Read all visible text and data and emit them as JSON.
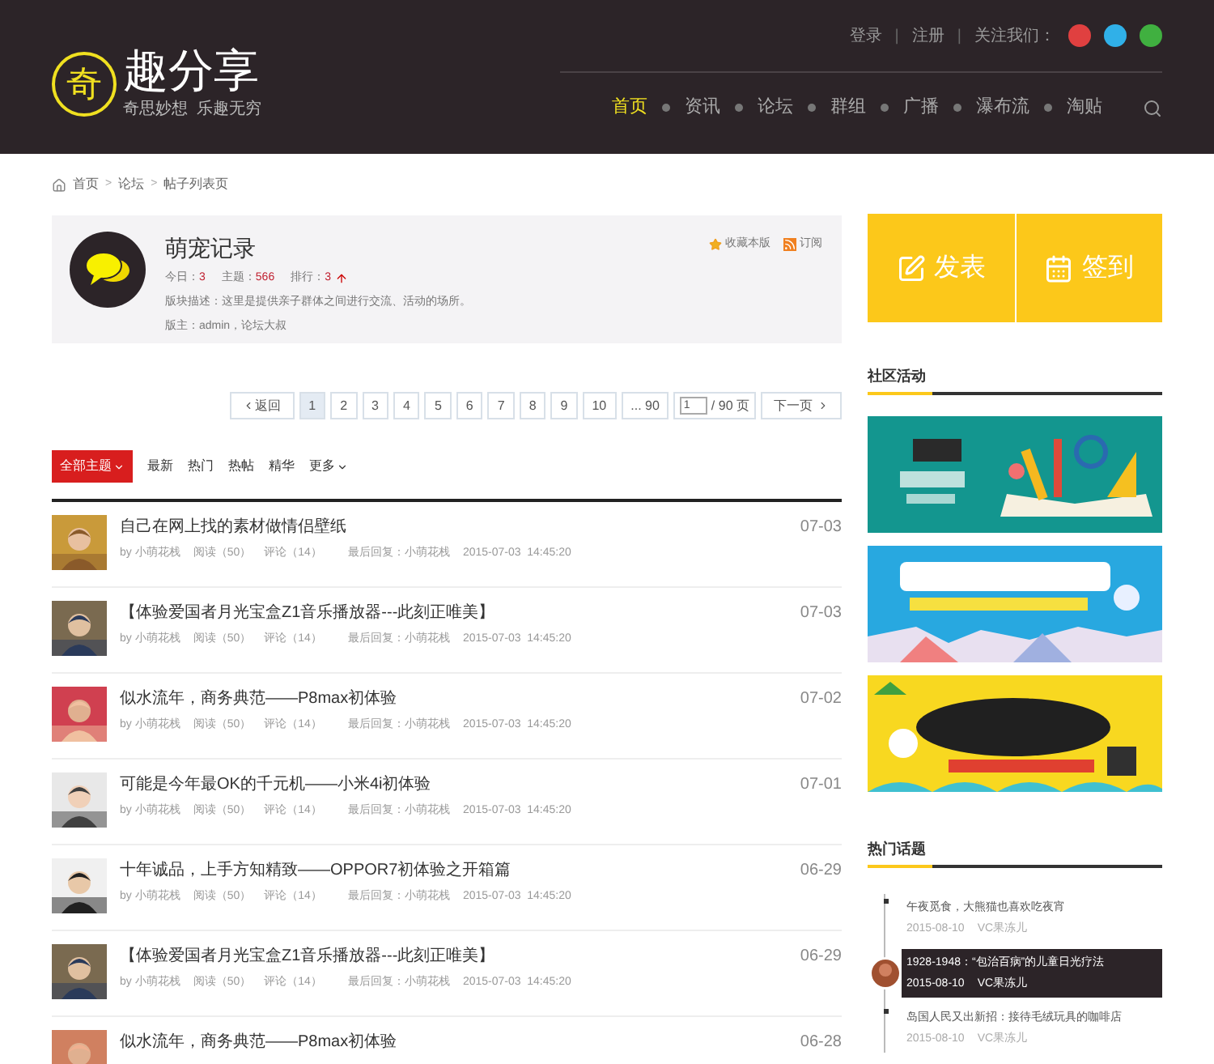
{
  "header": {
    "logo_char": "奇",
    "logo_title": "趣分享",
    "logo_slogan": "奇思妙想  乐趣无穷",
    "top_links": [
      "登录",
      "注册"
    ],
    "separator": "|",
    "follow_label": "关注我们：",
    "nav": [
      {
        "label": "首页",
        "selected": true
      },
      {
        "label": "资讯",
        "selected": false
      },
      {
        "label": "论坛",
        "selected": false
      },
      {
        "label": "群组",
        "selected": false
      },
      {
        "label": "广播",
        "selected": false
      },
      {
        "label": "瀑布流",
        "selected": false
      },
      {
        "label": "淘贴",
        "selected": false
      }
    ]
  },
  "breadcrumb": [
    {
      "kind": "link",
      "text": "首页"
    },
    {
      "kind": "separator",
      "text": ">"
    },
    {
      "kind": "link",
      "text": "论坛"
    },
    {
      "kind": "separator",
      "text": ">"
    },
    {
      "kind": "link",
      "text": "帖子列表页"
    }
  ],
  "forum": {
    "title": "萌宠记录",
    "stats": [
      {
        "label": "今日：",
        "value": "3"
      },
      {
        "label": "主题：",
        "value": "566"
      },
      {
        "label": "排行：",
        "value": "3"
      }
    ],
    "description": "版块描述：这里是提供亲子群体之间进行交流、活动的场所。",
    "moderators": "版主：admin，论坛大叔",
    "actions": [
      "收藏本版",
      "订阅"
    ]
  },
  "pagination": {
    "back": "返回",
    "pages": [
      {
        "label": "1",
        "selected": true
      },
      {
        "label": "2",
        "selected": false
      },
      {
        "label": "3",
        "selected": false
      },
      {
        "label": "4",
        "selected": false
      },
      {
        "label": "5",
        "selected": false
      },
      {
        "label": "6",
        "selected": false
      },
      {
        "label": "7",
        "selected": false
      },
      {
        "label": "8",
        "selected": false
      },
      {
        "label": "9",
        "selected": false
      },
      {
        "label": "10",
        "selected": false
      },
      {
        "label": "... 90",
        "selected": false
      }
    ],
    "page_input": "1",
    "total": "/ 90 页",
    "next": "下一页"
  },
  "filters": [
    {
      "label": "全部主题",
      "selected": true,
      "dropdown": true
    },
    {
      "label": "最新",
      "selected": false,
      "dropdown": false
    },
    {
      "label": "热门",
      "selected": false,
      "dropdown": false
    },
    {
      "label": "热帖",
      "selected": false,
      "dropdown": false
    },
    {
      "label": "精华",
      "selected": false,
      "dropdown": false
    },
    {
      "label": "更多",
      "selected": false,
      "dropdown": true
    }
  ],
  "posts": [
    {
      "title": "自己在网上找的素材做情侣壁纸",
      "author": "by 小萌花栈",
      "reads": "阅读（50）",
      "comments": "评论（14）",
      "last_reply": "最后回复：小萌花栈",
      "time": "2015-07-03  14:45:20",
      "date": "07-03"
    },
    {
      "title": "【体验爱国者月光宝盒Z1音乐播放器---此刻正唯美】",
      "author": "by 小萌花栈",
      "reads": "阅读（50）",
      "comments": "评论（14）",
      "last_reply": "最后回复：小萌花栈",
      "time": "2015-07-03  14:45:20",
      "date": "07-03"
    },
    {
      "title": "似水流年，商务典范——P8max初体验",
      "author": "by 小萌花栈",
      "reads": "阅读（50）",
      "comments": "评论（14）",
      "last_reply": "最后回复：小萌花栈",
      "time": "2015-07-03  14:45:20",
      "date": "07-02"
    },
    {
      "title": "可能是今年最OK的千元机——小米4i初体验",
      "author": "by 小萌花栈",
      "reads": "阅读（50）",
      "comments": "评论（14）",
      "last_reply": "最后回复：小萌花栈",
      "time": "2015-07-03  14:45:20",
      "date": "07-01"
    },
    {
      "title": "十年诚品，上手方知精致——OPPOR7初体验之开箱篇",
      "author": "by 小萌花栈",
      "reads": "阅读（50）",
      "comments": "评论（14）",
      "last_reply": "最后回复：小萌花栈",
      "time": "2015-07-03  14:45:20",
      "date": "06-29"
    },
    {
      "title": "【体验爱国者月光宝盒Z1音乐播放器---此刻正唯美】",
      "author": "by 小萌花栈",
      "reads": "阅读（50）",
      "comments": "评论（14）",
      "last_reply": "最后回复：小萌花栈",
      "time": "2015-07-03  14:45:20",
      "date": "06-29"
    },
    {
      "title": "似水流年，商务典范——P8max初体验",
      "date": "06-28"
    }
  ],
  "sidebar": {
    "actions": [
      {
        "kind": "post",
        "label": "发表"
      },
      {
        "kind": "checkin",
        "label": "签到"
      }
    ],
    "activities_title": "社区活动",
    "topics_title": "热门话题",
    "topics": [
      {
        "title": "午夜觅食，大熊猫也喜欢吃夜宵",
        "date": "2015-08-10",
        "author": "VC果冻儿",
        "selected": false
      },
      {
        "title": "1928-1948：“包治百病”的儿童日光疗法",
        "date": "2015-08-10",
        "author": "VC果冻儿",
        "selected": true
      },
      {
        "title": "岛国人民又出新招：接待毛绒玩具的咖啡店",
        "date": "2015-08-10",
        "author": "VC果冻儿",
        "selected": false
      }
    ]
  }
}
